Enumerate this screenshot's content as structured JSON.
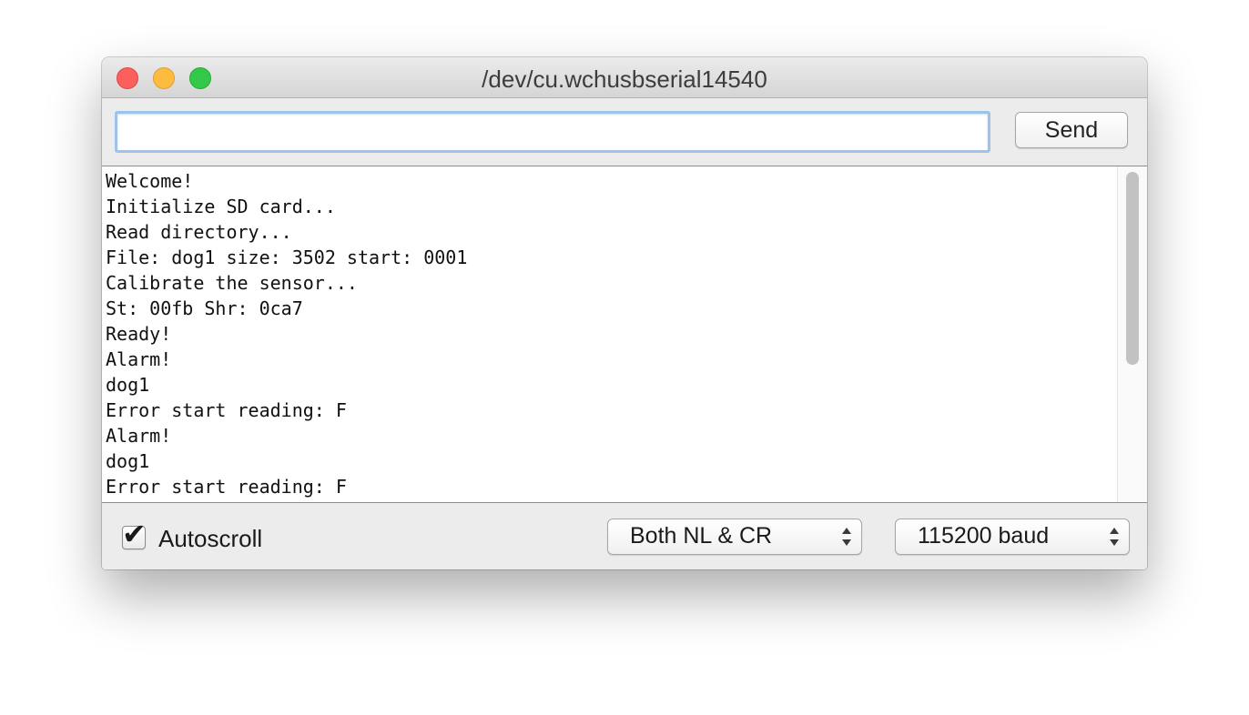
{
  "window": {
    "title": "/dev/cu.wchusbserial14540"
  },
  "toolbar": {
    "input_value": "",
    "send_label": "Send"
  },
  "output": {
    "lines": [
      "Welcome!",
      "Initialize SD card...",
      "Read directory...",
      "File: dog1 size: 3502 start: 0001",
      "Calibrate the sensor...",
      "St: 00fb Shr: 0ca7",
      "Ready!",
      "Alarm!",
      "dog1",
      "Error start reading: F",
      "Alarm!",
      "dog1",
      "Error start reading: F"
    ]
  },
  "bottom": {
    "autoscroll_label": "Autoscroll",
    "autoscroll_checked": true,
    "line_ending_value": "Both NL & CR",
    "baud_value": "115200 baud"
  },
  "colors": {
    "close": "#fc605c",
    "minimize": "#fdbc40",
    "zoom": "#34c84a",
    "input_focus_ring": "#9cc3ea"
  }
}
